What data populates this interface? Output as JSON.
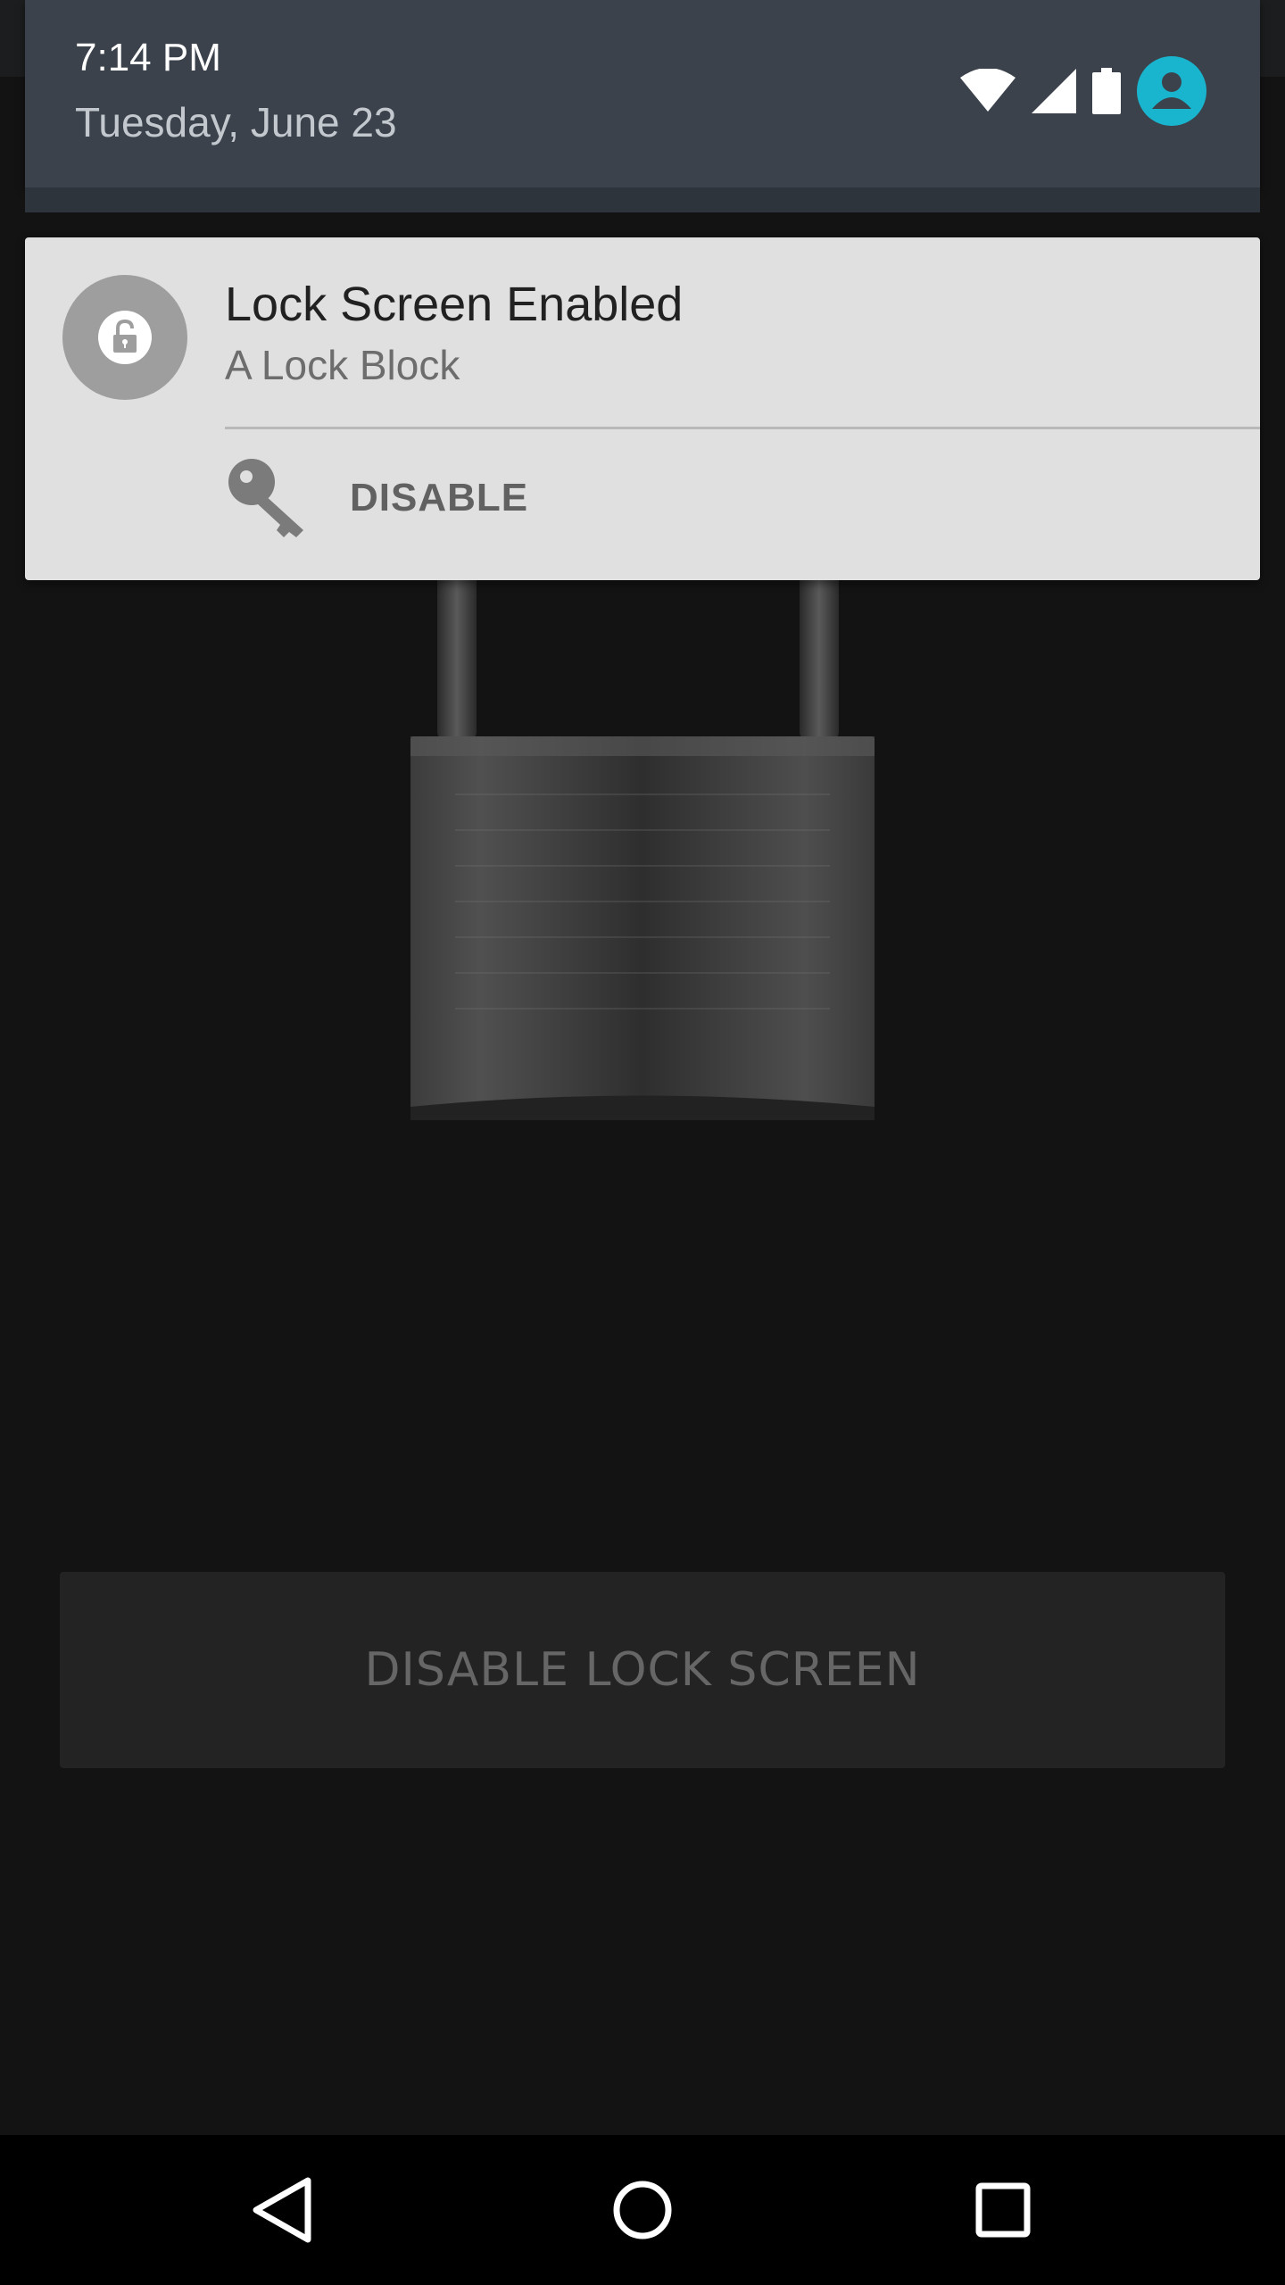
{
  "status_shade": {
    "time": "7:14 PM",
    "date": "Tuesday, June 23",
    "icons": [
      "wifi-icon",
      "cellular-signal-icon",
      "battery-icon",
      "user-avatar-icon"
    ],
    "avatar_color": "#19b5cf"
  },
  "notification": {
    "icon": "unlocked-padlock-icon",
    "title": "Lock Screen Enabled",
    "subtitle": "A Lock Block",
    "action": {
      "icon": "key-icon",
      "label": "DISABLE"
    }
  },
  "app": {
    "illustration": "padlock",
    "button_label": "DISABLE LOCK SCREEN"
  },
  "navigation": {
    "buttons": [
      "back-icon",
      "home-icon",
      "recents-icon"
    ]
  }
}
